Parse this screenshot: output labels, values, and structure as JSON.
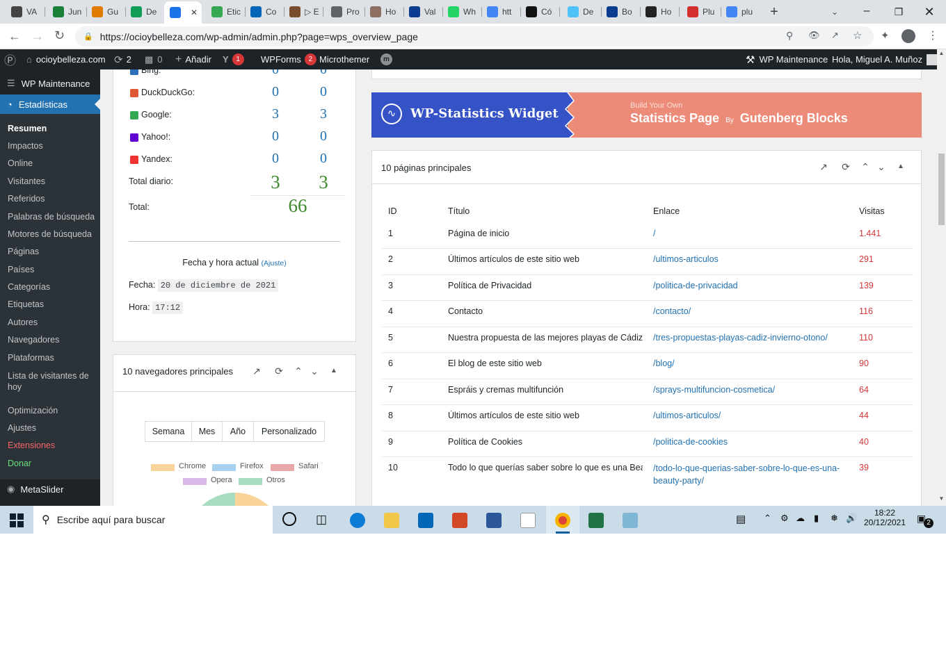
{
  "browser": {
    "tabs": [
      {
        "label": "VA",
        "color": "#444"
      },
      {
        "label": "Jun",
        "color": "#1a7f37"
      },
      {
        "label": "Gu",
        "color": "#e07b00"
      },
      {
        "label": "De",
        "color": "#0f9d58"
      },
      {
        "label": "",
        "color": "#1a73e8",
        "active": true
      },
      {
        "label": "Etic",
        "color": "#34a853"
      },
      {
        "label": "Co",
        "color": "#0364b8"
      },
      {
        "label": "▷ E",
        "color": "#7a4e2d"
      },
      {
        "label": "Pro",
        "color": "#5f6368"
      },
      {
        "label": "Ho",
        "color": "#8d6e63"
      },
      {
        "label": "Val",
        "color": "#0a3d91"
      },
      {
        "label": "Wh",
        "color": "#25d366"
      },
      {
        "label": "htt",
        "color": "#4285f4"
      },
      {
        "label": "Có",
        "color": "#111"
      },
      {
        "label": "De",
        "color": "#4fc3f7"
      },
      {
        "label": "Bo",
        "color": "#0a3d91"
      },
      {
        "label": "Ho",
        "color": "#222"
      },
      {
        "label": "Plu",
        "color": "#d32f2f"
      },
      {
        "label": "plu",
        "color": "#4285f4"
      }
    ],
    "url": "https://ocioybelleza.com/wp-admin/admin.php?page=wps_overview_page"
  },
  "adminbar": {
    "site": "ocioybelleza.com",
    "updates": "2",
    "comments": "0",
    "add": "Añadir",
    "yoast_count": "1",
    "wpforms": "WPForms",
    "wpforms_count": "2",
    "microthemer": "Microthemer",
    "maintenance": "WP Maintenance",
    "greeting": "Hola, Miguel A. Muñoz"
  },
  "sidebar": {
    "maintenance": "WP Maintenance",
    "stats": "Estadísticas",
    "items": [
      "Resumen",
      "Impactos",
      "Online",
      "Visitantes",
      "Referidos",
      "Palabras de búsqueda",
      "Motores de búsqueda",
      "Páginas",
      "Países",
      "Categorías",
      "Etiquetas",
      "Autores",
      "Navegadores",
      "Plataformas",
      "Lista de visitantes de hoy",
      "Optimización",
      "Ajustes",
      "Extensiones",
      "Donar"
    ],
    "metaslider": "MetaSlider"
  },
  "search_engines": {
    "rows": [
      {
        "name": "Bing:",
        "today": "0",
        "yesterday": "0"
      },
      {
        "name": "DuckDuckGo:",
        "today": "0",
        "yesterday": "0"
      },
      {
        "name": "Google:",
        "today": "3",
        "yesterday": "3"
      },
      {
        "name": "Yahoo!:",
        "today": "0",
        "yesterday": "0"
      },
      {
        "name": "Yandex:",
        "today": "0",
        "yesterday": "0"
      }
    ],
    "daily_label": "Total diario:",
    "daily_today": "3",
    "daily_yesterday": "3",
    "total_label": "Total:",
    "total": "66",
    "datetime_title": "Fecha y hora actual",
    "adjust": "(Ajuste)",
    "date_label": "Fecha:",
    "date_value": "20 de diciembre de 2021",
    "time_label": "Hora:",
    "time_value": "17:12"
  },
  "browsers_widget": {
    "title": "10 navegadores principales",
    "periods": [
      "Semana",
      "Mes",
      "Año",
      "Personalizado"
    ],
    "legend": [
      {
        "name": "Chrome",
        "color": "#f8d49a"
      },
      {
        "name": "Firefox",
        "color": "#a8d1f0"
      },
      {
        "name": "Safari",
        "color": "#e8a8a8"
      },
      {
        "name": "Opera",
        "color": "#d8b8e8"
      },
      {
        "name": "Otros",
        "color": "#a8dcc0"
      }
    ]
  },
  "banner": {
    "widget": "WP-Statistics Widget",
    "build": "Build Your Own",
    "stats_page": "Statistics Page",
    "by": "By",
    "gutenberg": "Gutenberg Blocks"
  },
  "top_pages": {
    "title": "10 páginas principales",
    "headers": {
      "id": "ID",
      "title": "Título",
      "link": "Enlace",
      "visits": "Visitas"
    },
    "rows": [
      {
        "id": "1",
        "title": "Página de inicio",
        "link": "/",
        "visits": "1.441"
      },
      {
        "id": "2",
        "title": "Últimos artículos de este sitio web",
        "link": "/ultimos-articulos",
        "visits": "291"
      },
      {
        "id": "3",
        "title": "Política de Privacidad",
        "link": "/politica-de-privacidad",
        "visits": "139"
      },
      {
        "id": "4",
        "title": "Contacto",
        "link": "/contacto/",
        "visits": "116"
      },
      {
        "id": "5",
        "title": "Nuestra propuesta de las mejores playas de Cádiz para",
        "link": "/tres-propuestas-playas-cadiz-invierno-otono/",
        "visits": "110"
      },
      {
        "id": "6",
        "title": "El blog de este sitio web",
        "link": "/blog/",
        "visits": "90"
      },
      {
        "id": "7",
        "title": "Espráis y cremas multifunción",
        "link": "/sprays-multifuncion-cosmetica/",
        "visits": "64"
      },
      {
        "id": "8",
        "title": "Últimos artículos de este sitio web",
        "link": "/ultimos-articulos/",
        "visits": "44"
      },
      {
        "id": "9",
        "title": "Política de Cookies",
        "link": "/politica-de-cookies",
        "visits": "40"
      },
      {
        "id": "10",
        "title": "Todo lo que querías saber sobre lo que es una Beauty",
        "link": "/todo-lo-que-querias-saber-sobre-lo-que-es-una-beauty-party/",
        "visits": "39"
      }
    ]
  },
  "taskbar": {
    "search_placeholder": "Escribe aquí para buscar",
    "time": "18:22",
    "date": "20/12/2021",
    "notifications": "2"
  }
}
